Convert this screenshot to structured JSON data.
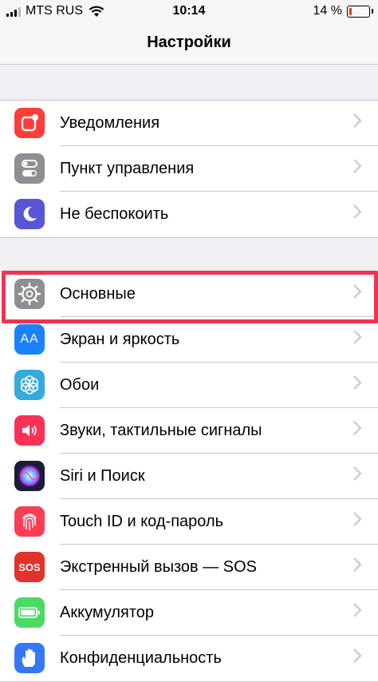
{
  "status_bar": {
    "carrier": "MTS RUS",
    "time": "10:14",
    "battery_text": "14 %",
    "battery_level": 0.14,
    "battery_color": "#e0362c"
  },
  "nav": {
    "title": "Настройки"
  },
  "groups": [
    {
      "items": [
        {
          "label": "Уведомления",
          "icon": "notifications-icon",
          "color": "#fc3d39"
        },
        {
          "label": "Пункт управления",
          "icon": "control-center-icon",
          "color": "#8e8e93"
        },
        {
          "label": "Не беспокоить",
          "icon": "moon-icon",
          "color": "#5856d6"
        }
      ]
    },
    {
      "items": [
        {
          "label": "Основные",
          "icon": "gear-icon",
          "color": "#8e8e93",
          "highlighted": true,
          "highlight_color": "#ee3354"
        },
        {
          "label": "Экран и яркость",
          "icon": "display-brightness-icon",
          "color": "#1a82fb",
          "glyph": "AA"
        },
        {
          "label": "Обои",
          "icon": "wallpaper-flower-icon",
          "color": "#35aadc"
        },
        {
          "label": "Звуки, тактильные сигналы",
          "icon": "speaker-icon",
          "color": "#fc3158"
        },
        {
          "label": "Siri и Поиск",
          "icon": "siri-icon",
          "color": "#1c1c3a"
        },
        {
          "label": "Touch ID и код-пароль",
          "icon": "fingerprint-icon",
          "color": "#fc3d55"
        },
        {
          "label": "Экстренный вызов — SOS",
          "icon": "sos-icon",
          "color": "#e3312c",
          "glyph": "SOS"
        },
        {
          "label": "Аккумулятор",
          "icon": "battery-icon",
          "color": "#4cd964"
        },
        {
          "label": "Конфиденциальность",
          "icon": "hand-icon",
          "color": "#3478f6"
        }
      ]
    }
  ]
}
